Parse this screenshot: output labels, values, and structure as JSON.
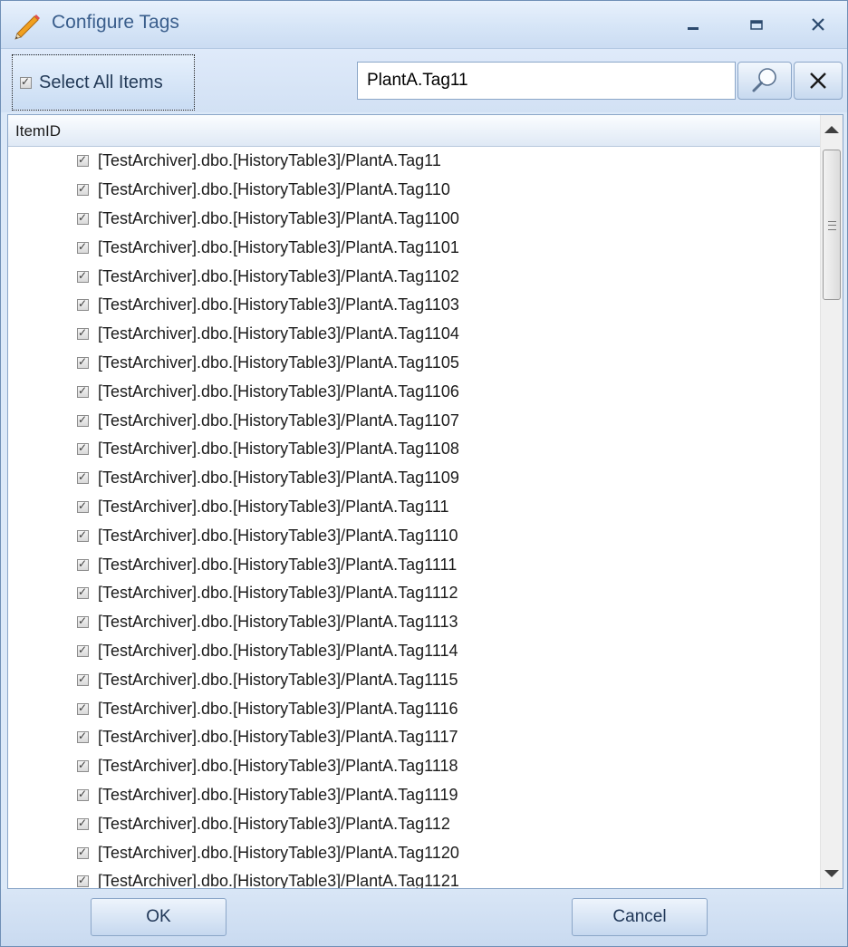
{
  "window": {
    "title": "Configure Tags",
    "icon": "pencil-icon",
    "controls": [
      "minimize-icon",
      "maximize-icon",
      "close-icon"
    ]
  },
  "toolbar": {
    "select_all_label": "Select All Items",
    "select_all_checked": true,
    "search_value": "PlantA.Tag11",
    "search_placeholder": "",
    "search_icon": "magnifier-icon",
    "clear_icon": "x-icon"
  },
  "grid": {
    "column_header": "ItemID",
    "rows": [
      "[TestArchiver].dbo.[HistoryTable3]/PlantA.Tag11",
      "[TestArchiver].dbo.[HistoryTable3]/PlantA.Tag110",
      "[TestArchiver].dbo.[HistoryTable3]/PlantA.Tag1100",
      "[TestArchiver].dbo.[HistoryTable3]/PlantA.Tag1101",
      "[TestArchiver].dbo.[HistoryTable3]/PlantA.Tag1102",
      "[TestArchiver].dbo.[HistoryTable3]/PlantA.Tag1103",
      "[TestArchiver].dbo.[HistoryTable3]/PlantA.Tag1104",
      "[TestArchiver].dbo.[HistoryTable3]/PlantA.Tag1105",
      "[TestArchiver].dbo.[HistoryTable3]/PlantA.Tag1106",
      "[TestArchiver].dbo.[HistoryTable3]/PlantA.Tag1107",
      "[TestArchiver].dbo.[HistoryTable3]/PlantA.Tag1108",
      "[TestArchiver].dbo.[HistoryTable3]/PlantA.Tag1109",
      "[TestArchiver].dbo.[HistoryTable3]/PlantA.Tag111",
      "[TestArchiver].dbo.[HistoryTable3]/PlantA.Tag1110",
      "[TestArchiver].dbo.[HistoryTable3]/PlantA.Tag1111",
      "[TestArchiver].dbo.[HistoryTable3]/PlantA.Tag1112",
      "[TestArchiver].dbo.[HistoryTable3]/PlantA.Tag1113",
      "[TestArchiver].dbo.[HistoryTable3]/PlantA.Tag1114",
      "[TestArchiver].dbo.[HistoryTable3]/PlantA.Tag1115",
      "[TestArchiver].dbo.[HistoryTable3]/PlantA.Tag1116",
      "[TestArchiver].dbo.[HistoryTable3]/PlantA.Tag1117",
      "[TestArchiver].dbo.[HistoryTable3]/PlantA.Tag1118",
      "[TestArchiver].dbo.[HistoryTable3]/PlantA.Tag1119",
      "[TestArchiver].dbo.[HistoryTable3]/PlantA.Tag112",
      "[TestArchiver].dbo.[HistoryTable3]/PlantA.Tag1120",
      "[TestArchiver].dbo.[HistoryTable3]/PlantA.Tag1121"
    ]
  },
  "footer": {
    "ok_label": "OK",
    "cancel_label": "Cancel"
  },
  "colors": {
    "title_text": "#3a5e8c",
    "chrome": "#dce9f8",
    "border": "#8ba6c8"
  }
}
